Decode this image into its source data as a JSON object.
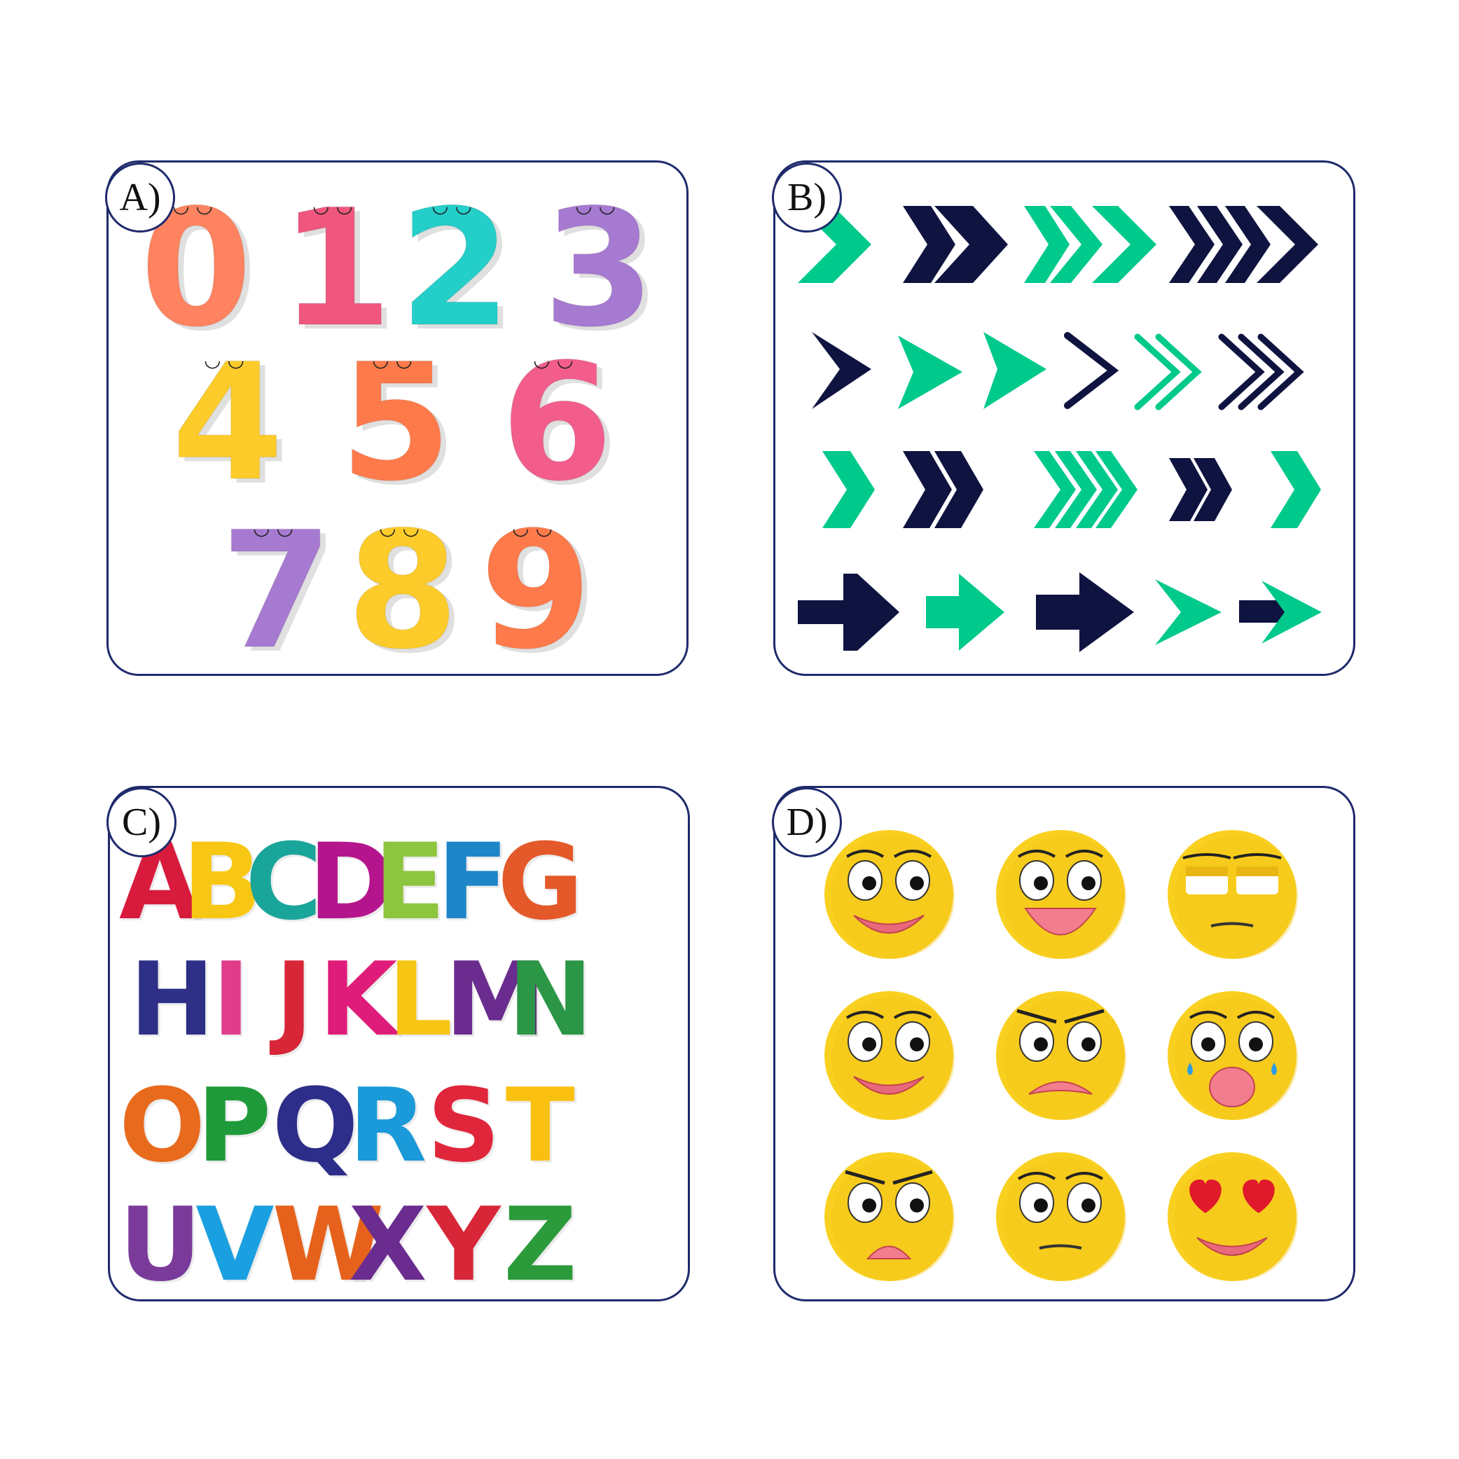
{
  "badges": {
    "a": "A)",
    "b": "B)",
    "c": "C)",
    "d": "D)"
  },
  "colors": {
    "border": "#1f2a6b",
    "navy": "#0e1340",
    "green": "#00c98c",
    "emoji_yellow": "#f9d020"
  },
  "numbers": [
    {
      "text": "0",
      "color": "#ff8360"
    },
    {
      "text": "1",
      "color": "#f0577e"
    },
    {
      "text": "2",
      "color": "#25cfc9"
    },
    {
      "text": "3",
      "color": "#a77ad1"
    },
    {
      "text": "4",
      "color": "#fdcc2a"
    },
    {
      "text": "5",
      "color": "#ff7a4a"
    },
    {
      "text": "6",
      "color": "#f25d8c"
    },
    {
      "text": "7",
      "color": "#a77ad1"
    },
    {
      "text": "8",
      "color": "#fdcc2a"
    },
    {
      "text": "9",
      "color": "#ff7a4a"
    }
  ],
  "letters": [
    {
      "text": "A",
      "color": "#d81b3d"
    },
    {
      "text": "B",
      "color": "#f7c713"
    },
    {
      "text": "C",
      "color": "#1aa59a"
    },
    {
      "text": "D",
      "color": "#b5158c"
    },
    {
      "text": "E",
      "color": "#8dc53e"
    },
    {
      "text": "F",
      "color": "#1e86c8"
    },
    {
      "text": "G",
      "color": "#e4592a"
    },
    {
      "text": "H",
      "color": "#2e2f86"
    },
    {
      "text": "I",
      "color": "#e03c8a"
    },
    {
      "text": "J",
      "color": "#d72638"
    },
    {
      "text": "K",
      "color": "#e01c7a"
    },
    {
      "text": "L",
      "color": "#f7c513"
    },
    {
      "text": "M",
      "color": "#6a2c8e"
    },
    {
      "text": "N",
      "color": "#2a9646"
    },
    {
      "text": "O",
      "color": "#e86a1c"
    },
    {
      "text": "P",
      "color": "#1e9a3a"
    },
    {
      "text": "Q",
      "color": "#2d2d8a"
    },
    {
      "text": "R",
      "color": "#1a9ad8"
    },
    {
      "text": "S",
      "color": "#e0263b"
    },
    {
      "text": "T",
      "color": "#f9c00f"
    },
    {
      "text": "U",
      "color": "#7a3a9a"
    },
    {
      "text": "V",
      "color": "#1aa0e0"
    },
    {
      "text": "W",
      "color": "#e6621c"
    },
    {
      "text": "X",
      "color": "#6a2c8e"
    },
    {
      "text": "Y",
      "color": "#d72638"
    },
    {
      "text": "Z",
      "color": "#2a9a3a"
    }
  ],
  "arrows": [
    {
      "style": "chevron-fill",
      "color": "green"
    },
    {
      "style": "double-chevron",
      "color": "navy"
    },
    {
      "style": "double-chevron",
      "color": "green"
    },
    {
      "style": "triple-chevron",
      "color": "navy"
    },
    {
      "style": "thin-chevron",
      "color": "navy"
    },
    {
      "style": "triangle",
      "color": "green"
    },
    {
      "style": "triangle",
      "color": "green"
    },
    {
      "style": "line-chevron",
      "color": "navy"
    },
    {
      "style": "double-line-chevron",
      "color": "green"
    },
    {
      "style": "triple-line-chevron",
      "color": "navy"
    },
    {
      "style": "chevron",
      "color": "green"
    },
    {
      "style": "double-chevron",
      "color": "navy"
    },
    {
      "style": "triple-chevron",
      "color": "green"
    },
    {
      "style": "double-chevron",
      "color": "navy"
    },
    {
      "style": "chevron",
      "color": "green"
    },
    {
      "style": "arrow",
      "color": "navy"
    },
    {
      "style": "arrow",
      "color": "green"
    },
    {
      "style": "thick-arrow",
      "color": "navy"
    },
    {
      "style": "arrowhead",
      "color": "green"
    },
    {
      "style": "bar-arrow",
      "color": "navy"
    }
  ],
  "emojis": [
    {
      "name": "smiling-face"
    },
    {
      "name": "laughing-face"
    },
    {
      "name": "annoyed-face"
    },
    {
      "name": "happy-face"
    },
    {
      "name": "angry-frowning-face"
    },
    {
      "name": "crying-face"
    },
    {
      "name": "angry-face"
    },
    {
      "name": "neutral-face"
    },
    {
      "name": "heart-eyes-face"
    }
  ]
}
